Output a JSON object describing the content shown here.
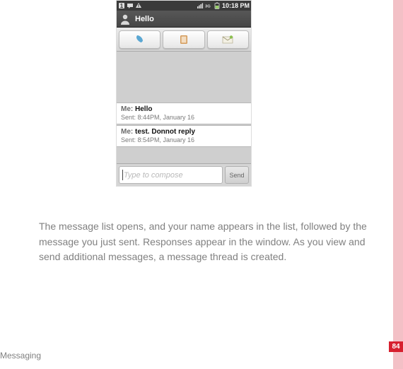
{
  "status": {
    "clock": "10:18 PM"
  },
  "title": "Hello",
  "messages": [
    {
      "sender": "Me:",
      "body": "Hello",
      "meta": "Sent: 8:44PM, January 16"
    },
    {
      "sender": "Me:",
      "body": "test. Donnot reply",
      "meta": "Sent: 8:54PM, January 16"
    }
  ],
  "compose": {
    "placeholder": "Type to compose",
    "send_label": "Send"
  },
  "description": "The message list opens, and your name appears in the list, followed by the message you just sent. Responses appear in the window. As you view and send additional messages, a message thread is created.",
  "footer": "Messaging",
  "page_number": "84"
}
